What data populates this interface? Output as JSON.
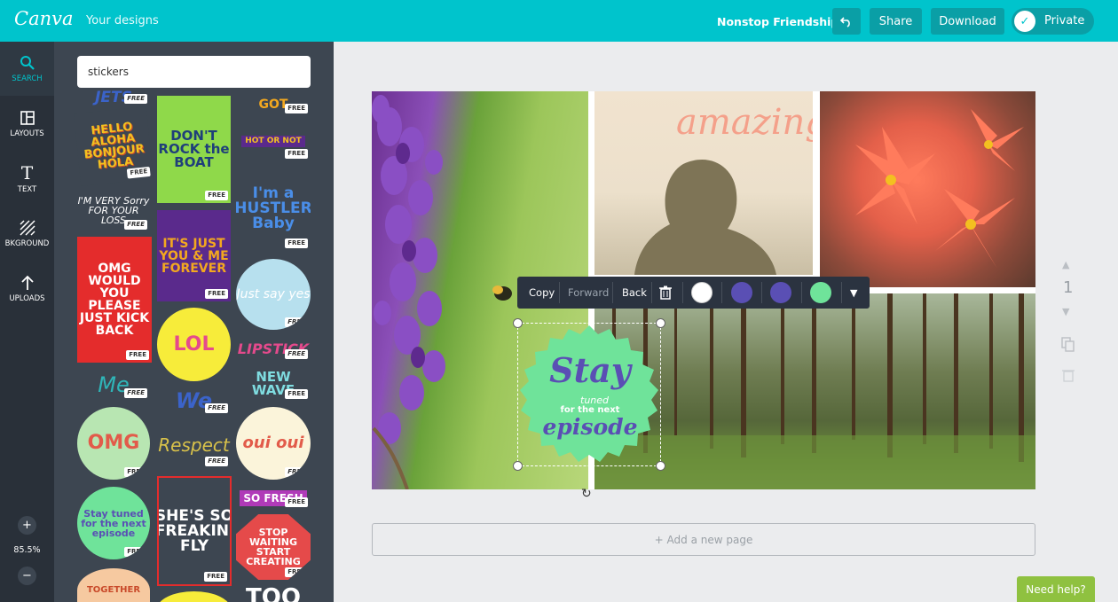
{
  "header": {
    "logo": "Canva",
    "your_designs": "Your designs",
    "design_title": "Nonstop Friendship",
    "share": "Share",
    "download": "Download",
    "private": "Private"
  },
  "rail": {
    "items": [
      {
        "label": "SEARCH",
        "icon": "search-icon"
      },
      {
        "label": "LAYOUTS",
        "icon": "layouts-icon"
      },
      {
        "label": "TEXT",
        "icon": "text-icon"
      },
      {
        "label": "BKGROUND",
        "icon": "background-icon"
      },
      {
        "label": "UPLOADS",
        "icon": "upload-icon"
      }
    ],
    "zoom": "85.5%"
  },
  "panel": {
    "search_value": "stickers",
    "free_badge": "FREE",
    "stickers": [
      "JETS",
      "HELLO ALOHA BONJOUR HOLA",
      "DON'T ROCK the BOAT",
      "GOT",
      "HOT OR NOT",
      "I'm a HUSTLER Baby",
      "I'M VERY Sorry FOR YOUR LOSS",
      "OMG WOULD YOU PLEASE JUST KICK BACK",
      "IT'S JUST YOU & ME FOREVER",
      "Just say yes",
      "LOL",
      "LIPSTICK",
      "Me",
      "NEW WAVE",
      "We",
      "OMG",
      "Respect",
      "oui oui",
      "Stay tuned for the next episode",
      "SHE'S SO FREAKIN' FLY",
      "SO FRESH",
      "STOP WAITING START CREATING",
      "TOGETHER",
      "TOO"
    ]
  },
  "canvas": {
    "woman_text": "amazing",
    "sticker": {
      "line1": "Stay",
      "line2": "tuned",
      "line3": "for the next",
      "line4": "episode"
    }
  },
  "toolbar": {
    "copy": "Copy",
    "forward": "Forward",
    "back": "Back",
    "swatches": [
      "#ffffff",
      "#5a4fb4",
      "#5a4fb4",
      "#6fe39a"
    ]
  },
  "side": {
    "page_number": "1"
  },
  "add_page": "+ Add a new page",
  "need_help": "Need help?",
  "colors": {
    "brand": "#00c4cc",
    "rail": "#293039",
    "panel": "#3d4651",
    "help": "#8fc140"
  }
}
